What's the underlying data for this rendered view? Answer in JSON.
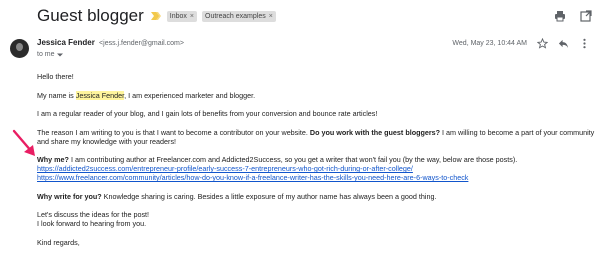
{
  "email": {
    "subject": "Guest blogger",
    "labels": [
      "Inbox",
      "Outreach examples"
    ],
    "label_close": "×",
    "sender_name": "Jessica Fender",
    "sender_email": "<jess.j.fender@gmail.com>",
    "to": "to me",
    "date": "Wed, May 23, 10:44 AM"
  },
  "body": {
    "greeting": "Hello there!",
    "intro_before": "My name is ",
    "intro_name": "Jessica Fender",
    "intro_after": ", I am experienced marketer and blogger.",
    "reader": "I am a regular reader of your blog, and I gain lots of benefits from your conversion and bounce rate articles!",
    "reason_before": "The reason I am writing to you is that I want to become a contributor on your website. ",
    "reason_bold": "Do you work with the guest bloggers?",
    "reason_after_1": " I am willing to become a part of your community",
    "reason_after_2": "and share my knowledge with your readers!",
    "whyme_bold": "Why me?",
    "whyme_text": " I am contributing author at Freelancer.com and Addicted2Success, so you get a writer that won't fail you (by the way, below are those posts).",
    "link1": "https://addicted2success.com/entrepreneur-profile/early-success-7-entrepreneurs-who-got-rich-during-or-after-college/",
    "link2": "https://www.freelancer.com/community/articles/how-do-you-know-if-a-freelance-writer-has-the-skills-you-need-here-are-6-ways-to-check",
    "whywrite_bold": "Why write for you?",
    "whywrite_text": " Knowledge sharing is caring. Besides a little exposure of my author name has always been a good thing.",
    "discuss": "Let's discuss the ideas for the post!",
    "forward": "I look forward to hearing from you.",
    "regards": "Kind regards,"
  },
  "icons": {
    "importance": "importance-marker-icon",
    "print": "print-icon",
    "open_new": "open-in-new-window-icon",
    "star": "star-icon",
    "reply": "reply-icon",
    "more": "more-options-icon",
    "dropdown": "chevron-down-icon",
    "annotation": "pink-arrow-icon"
  },
  "colors": {
    "link": "#1155cc",
    "highlight": "#fff59d",
    "importance": "#f2c94c",
    "arrow": "#e91e63"
  }
}
